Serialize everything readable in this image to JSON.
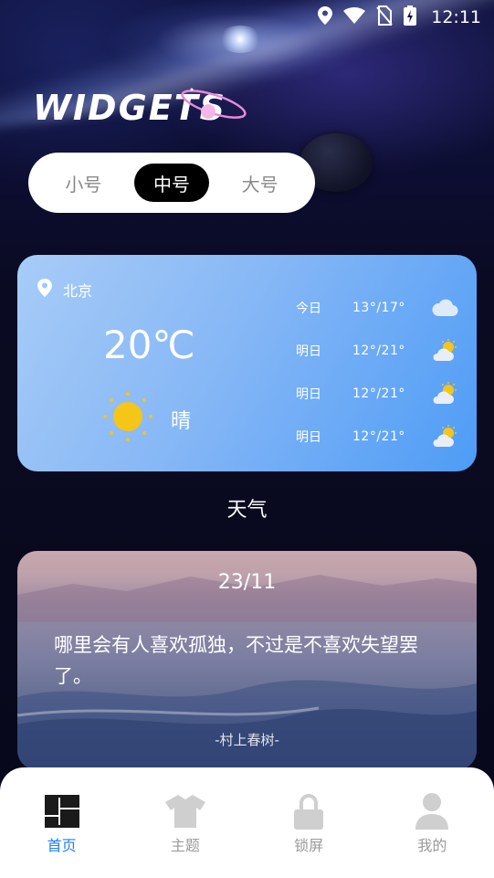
{
  "status_bar": {
    "time": "12:11",
    "icons": [
      "location-icon",
      "wifi-icon",
      "no-sim-icon",
      "battery-charging-icon"
    ]
  },
  "header": {
    "title": "WIDGETS"
  },
  "size_tabs": [
    {
      "label": "小号",
      "active": false
    },
    {
      "label": "中号",
      "active": true
    },
    {
      "label": "大号",
      "active": false
    }
  ],
  "weather": {
    "location": "北京",
    "temperature": "20℃",
    "condition": "晴",
    "forecast": [
      {
        "day": "今日",
        "range": "13°/17°",
        "icon": "cloud-icon"
      },
      {
        "day": "明日",
        "range": "12°/21°",
        "icon": "partly-sunny-icon"
      },
      {
        "day": "明日",
        "range": "12°/21°",
        "icon": "partly-sunny-icon"
      },
      {
        "day": "明日",
        "range": "12°/21°",
        "icon": "partly-sunny-icon"
      }
    ]
  },
  "weather_section_label": "天气",
  "quote": {
    "date": "23/11",
    "text": "哪里会有人喜欢孤独，不过是不喜欢失望罢了。",
    "author": "-村上春树-"
  },
  "bottom_nav": [
    {
      "label": "首页",
      "icon": "home-grid-icon",
      "active": true
    },
    {
      "label": "主题",
      "icon": "tshirt-icon",
      "active": false
    },
    {
      "label": "锁屏",
      "icon": "lock-icon",
      "active": false
    },
    {
      "label": "我的",
      "icon": "user-icon",
      "active": false
    }
  ],
  "colors": {
    "accent": "#1f7ef5",
    "weather_card_start": "#a7ccf7",
    "weather_card_end": "#4e9cf6",
    "background": "#0a0a22"
  }
}
